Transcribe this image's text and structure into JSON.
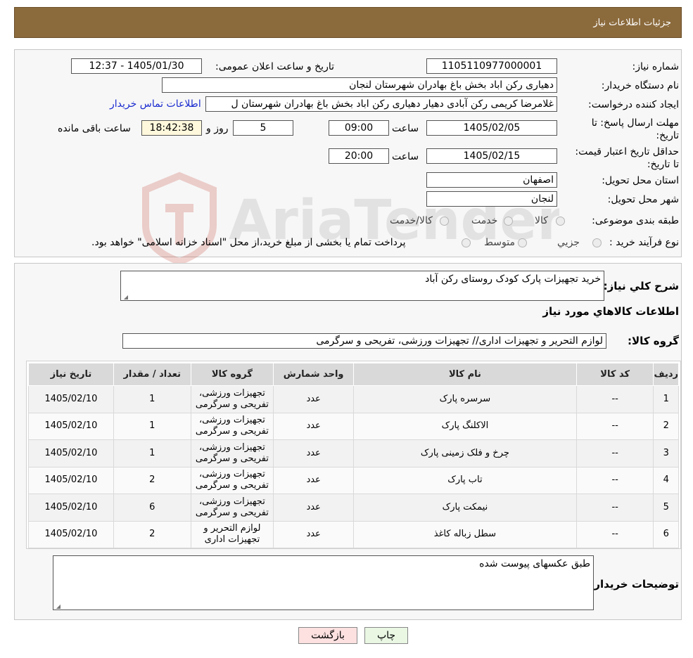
{
  "header": {
    "title": "جزئیات اطلاعات نیاز"
  },
  "form": {
    "need_number_label": "شماره نیاز:",
    "need_number": "1105110977000001",
    "announce_label": "تاریخ و ساعت اعلان عمومی:",
    "announce_value": "1405/01/30 - 12:37",
    "buyer_org_label": "نام دستگاه خریدار:",
    "buyer_org": "دهیاری رکن اباد بخش باغ بهادران شهرستان لنجان",
    "requester_label": "ایجاد کننده درخواست:",
    "requester": "غلامرضا کریمی رکن آبادی دهیار  دهیاری رکن اباد بخش باغ بهادران شهرستان ل",
    "contact_link": "اطلاعات تماس خریدار",
    "deadline_label": "مهلت ارسال پاسخ: تا تاریخ:",
    "deadline_date": "1405/02/05",
    "time_label": "ساعت",
    "deadline_time": "09:00",
    "days_value": "5",
    "days_label": "روز و",
    "remaining_time": "18:42:38",
    "remaining_label": "ساعت باقی مانده",
    "validity_label": "حداقل تاریخ اعتبار قیمت: تا تاریخ:",
    "validity_date": "1405/02/15",
    "validity_time": "20:00",
    "province_label": "استان محل تحویل:",
    "province": "اصفهان",
    "city_label": "شهر محل تحویل:",
    "city": "لنجان",
    "category_label": "طبقه بندی موضوعی:",
    "category_options": [
      "کالا",
      "خدمت",
      "کالا/خدمت"
    ],
    "process_label": "نوع فرآیند خرید :",
    "process_options": [
      "جزیي",
      "متوسط"
    ],
    "process_note": "پرداخت تمام یا بخشی از مبلغ خرید،از محل \"اسناد خزانه اسلامی\" خواهد بود."
  },
  "details": {
    "summary_label": "شرح کلي نياز:",
    "summary": "خرید تجهیزات پارک کودک روستای رکن آباد",
    "goods_title": "اطلاعات کالاهاي مورد نياز",
    "group_label": "گروه کالا:",
    "group_value": "لوازم التحریر و تجهیزات اداری// تجهیزات ورزشی، تفریحی و سرگرمی"
  },
  "table": {
    "headers": [
      "ردیف",
      "کد کالا",
      "نام کالا",
      "واحد شمارش",
      "گروه کالا",
      "تعداد / مقدار",
      "تاریخ نیاز"
    ],
    "rows": [
      [
        "1",
        "--",
        "سرسره پارک",
        "عدد",
        "تجهیزات ورزشی، تفریحی و سرگرمی",
        "1",
        "1405/02/10"
      ],
      [
        "2",
        "--",
        "الاکلنگ پارک",
        "عدد",
        "تجهیزات ورزشی، تفریحی و سرگرمی",
        "1",
        "1405/02/10"
      ],
      [
        "3",
        "--",
        "چرخ و فلک زمینی پارک",
        "عدد",
        "تجهیزات ورزشی، تفریحی و سرگرمی",
        "1",
        "1405/02/10"
      ],
      [
        "4",
        "--",
        "تاب پارک",
        "عدد",
        "تجهیزات ورزشی، تفریحی و سرگرمی",
        "2",
        "1405/02/10"
      ],
      [
        "5",
        "--",
        "نیمکت پارک",
        "عدد",
        "تجهیزات ورزشی، تفریحی و سرگرمی",
        "6",
        "1405/02/10"
      ],
      [
        "6",
        "--",
        "سطل زباله کاغذ",
        "عدد",
        "لوازم التحریر و تجهیزات اداری",
        "2",
        "1405/02/10"
      ]
    ]
  },
  "buyer_notes": {
    "label": "توضیحات خریدار:",
    "value": "طبق عکسهای پیوست شده"
  },
  "buttons": {
    "back": "بازگشت",
    "print": "چاپ"
  },
  "watermark": {
    "text": "AriaTender.neT"
  }
}
